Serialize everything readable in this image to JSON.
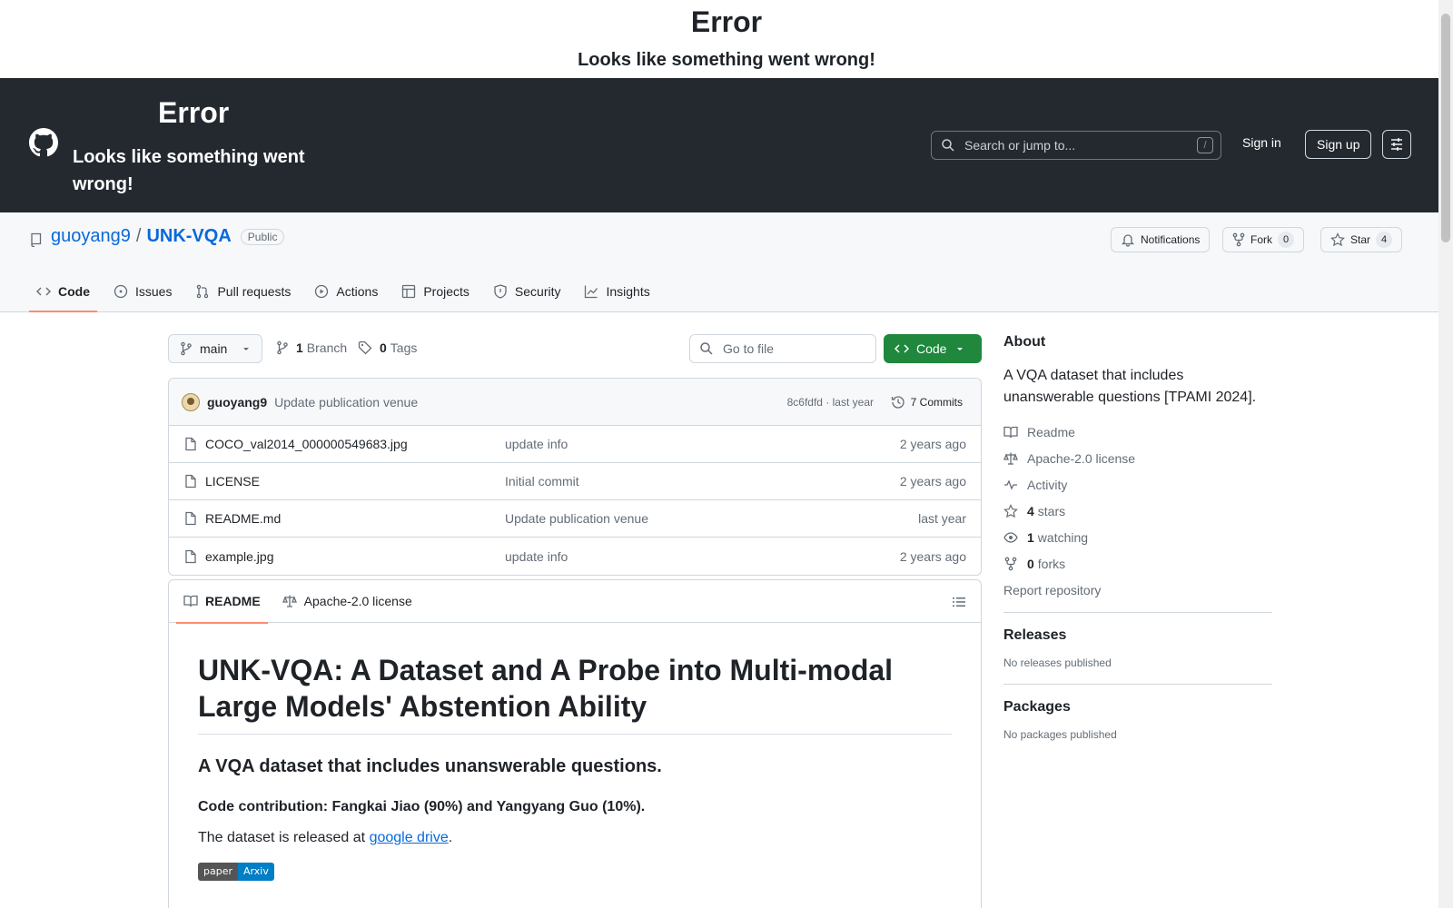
{
  "error_top": {
    "title": "Error",
    "subtitle": "Looks like something went wrong!"
  },
  "header": {
    "error_title": "Error",
    "error_subtitle": "Looks like something went wrong!",
    "search_placeholder": "Search or jump to...",
    "search_shortcut": "/",
    "sign_in": "Sign in",
    "sign_up": "Sign up"
  },
  "repo": {
    "owner": "guoyang9",
    "separator": "/",
    "name": "UNK-VQA",
    "visibility": "Public",
    "notifications_label": "Notifications",
    "fork_label": "Fork",
    "fork_count": "0",
    "star_label": "Star",
    "star_count": "4"
  },
  "tabs": [
    {
      "label": "Code",
      "icon": "code-icon"
    },
    {
      "label": "Issues",
      "icon": "issue-icon"
    },
    {
      "label": "Pull requests",
      "icon": "pull-request-icon"
    },
    {
      "label": "Actions",
      "icon": "play-icon"
    },
    {
      "label": "Projects",
      "icon": "table-icon"
    },
    {
      "label": "Security",
      "icon": "shield-icon"
    },
    {
      "label": "Insights",
      "icon": "graph-icon"
    }
  ],
  "filenav": {
    "branch": "main",
    "branch_count": "1",
    "branch_label": "Branch",
    "tag_count": "0",
    "tag_label": "Tags",
    "goto_placeholder": "Go to file",
    "code_button": "Code"
  },
  "commit": {
    "author": "guoyang9",
    "message": "Update publication venue",
    "sha_time": "8c6fdfd · last year",
    "commits_label": "7 Commits"
  },
  "files": [
    {
      "name": "COCO_val2014_000000549683.jpg",
      "message": "update info",
      "date": "2 years ago"
    },
    {
      "name": "LICENSE",
      "message": "Initial commit",
      "date": "2 years ago"
    },
    {
      "name": "README.md",
      "message": "Update publication venue",
      "date": "last year"
    },
    {
      "name": "example.jpg",
      "message": "update info",
      "date": "2 years ago"
    }
  ],
  "readme": {
    "tab_readme": "README",
    "tab_license": "Apache-2.0 license",
    "h1": "UNK-VQA: A Dataset and A Probe into Multi-modal Large Models' Abstention Ability",
    "h3": "A VQA dataset that includes unanswerable questions.",
    "contribution": "Code contribution: Fangkai Jiao (90%) and Yangyang Guo (10%).",
    "release_prefix": "The dataset is released at ",
    "release_link": "google drive",
    "release_suffix": ".",
    "badge_left": "paper",
    "badge_right": "Arxiv"
  },
  "sidebar": {
    "about_title": "About",
    "about_desc": "A VQA dataset that includes unanswerable questions [TPAMI 2024].",
    "readme": "Readme",
    "license": "Apache-2.0 license",
    "activity": "Activity",
    "stars_count": "4",
    "stars_label": "stars",
    "watching_count": "1",
    "watching_label": "watching",
    "forks_count": "0",
    "forks_label": "forks",
    "report": "Report repository",
    "releases_title": "Releases",
    "releases_text": "No releases published",
    "packages_title": "Packages",
    "packages_text": "No packages published"
  },
  "colors": {
    "header_bg": "#24292f",
    "accent": "#0969da",
    "primary_button": "#1f883d",
    "tab_underline": "#fd8c73"
  }
}
